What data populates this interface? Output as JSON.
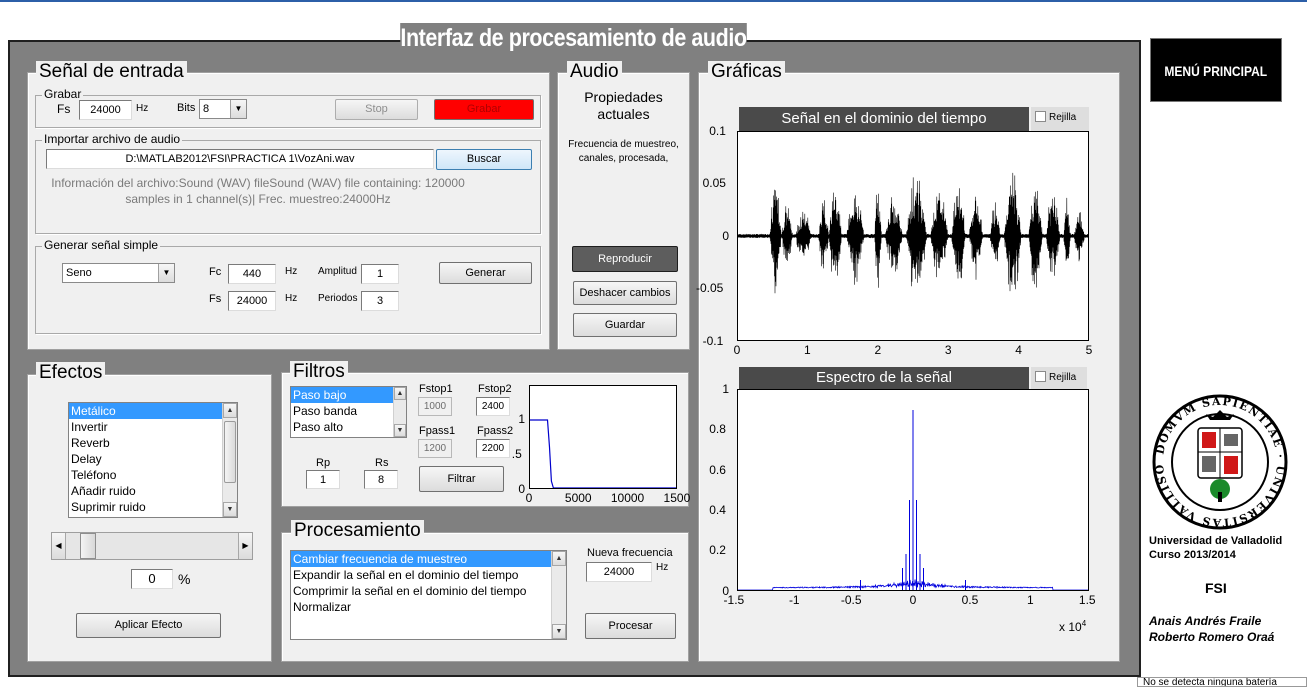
{
  "window": {
    "title": "Interfaz de procesamiento de audio"
  },
  "status_bar": {
    "text": "No se detecta ninguna batería"
  },
  "menu_principal": {
    "label": "MENÚ PRINCIPAL"
  },
  "input_panel": {
    "title": "Señal de entrada",
    "record": {
      "group_title": "Grabar",
      "fs_label": "Fs",
      "fs_value": "24000",
      "hz_label": "Hz",
      "bits_label": "Bits",
      "bits_value": "8",
      "stop_label": "Stop",
      "record_label": "Grabar"
    },
    "import": {
      "group_title": "Importar archivo de audio",
      "path": "D:\\MATLAB2012\\FSI\\PRACTICA 1\\VozAni.wav",
      "browse_label": "Buscar",
      "info_text": "Información del archivo:Sound (WAV) fileSound (WAV) file containing: 120000 samples in 1 channel(s)| Frec. muestreo:24000Hz"
    },
    "simple": {
      "group_title": "Generar señal simple",
      "waveform": "Seno",
      "fc_label": "Fc",
      "fc_value": "440",
      "fc_hz": "Hz",
      "fs_label": "Fs",
      "fs_value": "24000",
      "fs_hz": "Hz",
      "amp_label": "Amplitud",
      "amp_value": "1",
      "periods_label": "Periodos",
      "periods_value": "3",
      "generate_label": "Generar"
    }
  },
  "audio_panel": {
    "title": "Audio",
    "props_title": "Propiedades actuales",
    "props_text": "Frecuencia de muestreo, canales, procesada,",
    "play_label": "Reproducir",
    "undo_label": "Deshacer cambios",
    "save_label": "Guardar"
  },
  "graphs_panel": {
    "title": "Gráficas",
    "time_plot": {
      "title": "Señal en el dominio del tiempo",
      "grid_label": "Rejilla"
    },
    "spectrum_plot": {
      "title": "Espectro de la señal",
      "grid_label": "Rejilla",
      "exponent_label": "x 10",
      "exponent_power": "4"
    }
  },
  "effects_panel": {
    "title": "Efectos",
    "items": [
      "Metálico",
      "Invertir",
      "Reverb",
      "Delay",
      "Teléfono",
      "Añadir ruido",
      "Suprimir ruido"
    ],
    "selected_index": 0,
    "slider_value": 0.0,
    "percent_value": "0",
    "percent_label": "%",
    "apply_label": "Aplicar Efecto"
  },
  "filters_panel": {
    "title": "Filtros",
    "types": [
      "Paso bajo",
      "Paso banda",
      "Paso alto"
    ],
    "selected_index": 0,
    "fstop1_label": "Fstop1",
    "fstop1_value": "1000",
    "fstop2_label": "Fstop2",
    "fstop2_value": "2400",
    "fpass1_label": "Fpass1",
    "fpass1_value": "1200",
    "fpass2_label": "Fpass2",
    "fpass2_value": "2200",
    "rp_label": "Rp",
    "rp_value": "1",
    "rs_label": "Rs",
    "rs_value": "8",
    "filter_label": "Filtrar"
  },
  "processing_panel": {
    "title": "Procesamiento",
    "items": [
      "Cambiar frecuencia de muestreo",
      "Expandir la señal en el dominio del tiempo",
      "Comprimir la señal en el dominio del tiempo",
      "Normalizar"
    ],
    "selected_index": 0,
    "new_freq_label": "Nueva frecuencia",
    "new_freq_value": "24000",
    "hz_label": "Hz",
    "process_label": "Procesar"
  },
  "credits": {
    "university": "Universidad de Valladolid",
    "course": "Curso 2013/2014",
    "subject": "FSI",
    "author1": "Anais Andrés Fraile",
    "author2": "Roberto Romero Oraá",
    "seal_text": "DOMVM SAPIENTIAE · UNIVERSITAS VALLISOLETANA"
  },
  "chart_data": [
    {
      "type": "line",
      "name": "time_domain",
      "xlim": [
        0,
        5
      ],
      "ylim": [
        -0.1,
        0.1
      ],
      "xticks": [
        "0",
        "1",
        "2",
        "3",
        "4",
        "5"
      ],
      "yticks": [
        "0.1",
        "0.05",
        "0",
        "-0.05",
        "-0.1"
      ],
      "bursts": [
        {
          "start": 0.45,
          "end": 0.62,
          "amp": 0.06
        },
        {
          "start": 0.62,
          "end": 0.78,
          "amp": 0.035
        },
        {
          "start": 0.82,
          "end": 1.05,
          "amp": 0.03
        },
        {
          "start": 1.15,
          "end": 1.3,
          "amp": 0.04
        },
        {
          "start": 1.3,
          "end": 1.48,
          "amp": 0.06
        },
        {
          "start": 1.55,
          "end": 1.8,
          "amp": 0.05
        },
        {
          "start": 1.95,
          "end": 2.05,
          "amp": 0.06
        },
        {
          "start": 2.1,
          "end": 2.35,
          "amp": 0.045
        },
        {
          "start": 2.4,
          "end": 2.7,
          "amp": 0.07
        },
        {
          "start": 2.75,
          "end": 3.0,
          "amp": 0.055
        },
        {
          "start": 3.05,
          "end": 3.25,
          "amp": 0.06
        },
        {
          "start": 3.3,
          "end": 3.5,
          "amp": 0.045
        },
        {
          "start": 3.6,
          "end": 3.75,
          "amp": 0.04
        },
        {
          "start": 3.8,
          "end": 4.05,
          "amp": 0.07
        },
        {
          "start": 4.15,
          "end": 4.35,
          "amp": 0.06
        },
        {
          "start": 4.4,
          "end": 4.6,
          "amp": 0.05
        },
        {
          "start": 4.65,
          "end": 4.75,
          "amp": 0.04
        },
        {
          "start": 4.8,
          "end": 4.95,
          "amp": 0.03
        }
      ]
    },
    {
      "type": "line",
      "name": "spectrum",
      "xlim": [
        -1.5,
        1.5
      ],
      "ylim": [
        0,
        1
      ],
      "xticks": [
        "-1.5",
        "-1",
        "-0.5",
        "0",
        "0.5",
        "1",
        "1.5"
      ],
      "yticks": [
        "1",
        "0.8",
        "0.6",
        "0.4",
        "0.2",
        "0"
      ],
      "peaks": [
        {
          "x": 0.0,
          "y": 0.9
        },
        {
          "x": -0.03,
          "y": 0.45
        },
        {
          "x": 0.03,
          "y": 0.45
        },
        {
          "x": -0.06,
          "y": 0.18
        },
        {
          "x": 0.06,
          "y": 0.18
        },
        {
          "x": -0.09,
          "y": 0.11
        },
        {
          "x": 0.09,
          "y": 0.11
        },
        {
          "x": -0.45,
          "y": 0.05
        },
        {
          "x": 0.45,
          "y": 0.05
        }
      ],
      "support": [
        -1.2,
        1.2
      ]
    },
    {
      "type": "line",
      "name": "filter_response",
      "xlim": [
        0,
        15000
      ],
      "ylim": [
        0,
        1.5
      ],
      "xticks": [
        "0",
        "5000",
        "10000",
        "1500"
      ],
      "yticks": [
        "1",
        ".5",
        "0"
      ],
      "x": [
        0,
        1800,
        2000,
        2200,
        2400,
        15000
      ],
      "y": [
        1.0,
        1.0,
        0.6,
        0.1,
        0.0,
        0.0
      ]
    }
  ]
}
